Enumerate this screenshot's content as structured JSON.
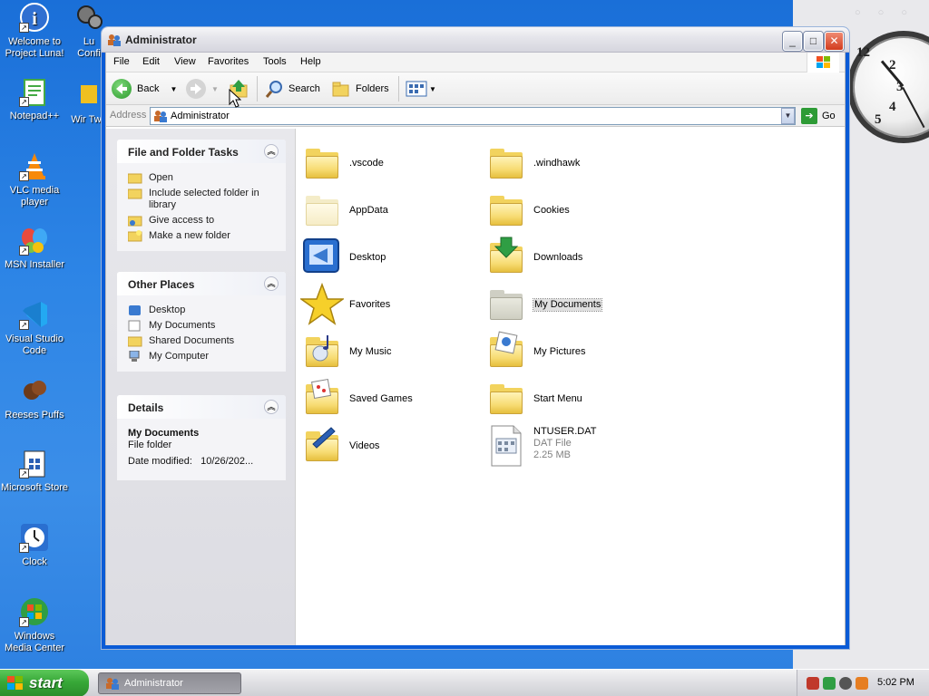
{
  "desktop": {
    "icons": [
      {
        "label": "Welcome to Project Luna!"
      },
      {
        "label": "Lu Confi"
      },
      {
        "label": "Notepad++"
      },
      {
        "label": "Wir Twe"
      },
      {
        "label": "VLC media player"
      },
      {
        "label": "MSN Installer"
      },
      {
        "label": "Visual Studio Code"
      },
      {
        "label": "Reeses Puffs"
      },
      {
        "label": "Microsoft Store"
      },
      {
        "label": "Clock"
      },
      {
        "label": "Windows Media Center"
      }
    ]
  },
  "clock_gadget": {
    "numbers": [
      "12",
      "2",
      "3",
      "4",
      "5"
    ]
  },
  "window": {
    "title": "Administrator",
    "controls": {
      "minimize": "_",
      "maximize": "□",
      "close": "✕"
    },
    "menu": [
      "File",
      "Edit",
      "View",
      "Favorites",
      "Tools",
      "Help"
    ],
    "toolbar": {
      "back_label": "Back",
      "search_label": "Search",
      "folders_label": "Folders"
    },
    "address": {
      "label": "Address",
      "value": "Administrator",
      "go_label": "Go"
    }
  },
  "taskpane": {
    "file_tasks": {
      "title": "File and Folder Tasks",
      "items": [
        {
          "label": "Open",
          "icon": "open-folder-icon"
        },
        {
          "label": "Include selected folder in library",
          "icon": "library-icon"
        },
        {
          "label": "Give access to",
          "icon": "share-icon"
        },
        {
          "label": "Make a new folder",
          "icon": "new-folder-icon"
        }
      ]
    },
    "other_places": {
      "title": "Other Places",
      "items": [
        {
          "label": "Desktop",
          "icon": "desktop-icon"
        },
        {
          "label": "My Documents",
          "icon": "my-documents-icon"
        },
        {
          "label": "Shared Documents",
          "icon": "folder-icon"
        },
        {
          "label": "My Computer",
          "icon": "computer-icon"
        }
      ]
    },
    "details": {
      "title": "Details",
      "name": "My Documents",
      "type": "File folder",
      "modified": "Date modified:   10/26/202..."
    }
  },
  "files": [
    {
      "name": ".vscode",
      "icon": "folder-icon"
    },
    {
      "name": ".windhawk",
      "icon": "folder-icon"
    },
    {
      "name": "AppData",
      "icon": "hidden-folder-icon"
    },
    {
      "name": "Cookies",
      "icon": "folder-icon"
    },
    {
      "name": "Desktop",
      "icon": "desktop-folder-icon"
    },
    {
      "name": "Downloads",
      "icon": "downloads-folder-icon"
    },
    {
      "name": "Favorites",
      "icon": "star-icon"
    },
    {
      "name": "My Documents",
      "icon": "gray-folder-icon",
      "selected": true
    },
    {
      "name": "My Music",
      "icon": "music-folder-icon"
    },
    {
      "name": "My Pictures",
      "icon": "pictures-folder-icon"
    },
    {
      "name": "Saved Games",
      "icon": "games-folder-icon"
    },
    {
      "name": "Start Menu",
      "icon": "folder-icon"
    },
    {
      "name": "Videos",
      "icon": "videos-folder-icon"
    },
    {
      "name": "NTUSER.DAT",
      "type": "DAT File",
      "size": "2.25 MB",
      "icon": "dat-file-icon"
    }
  ],
  "taskbar": {
    "start_label": "start",
    "task_label": "Administrator",
    "time": "5:02 PM"
  }
}
